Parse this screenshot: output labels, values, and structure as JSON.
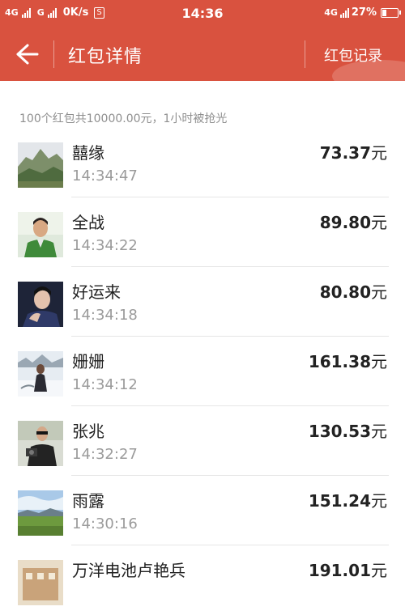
{
  "status_bar": {
    "network1": "4G",
    "network2": "G",
    "speed": "0K/s",
    "box_icon_label": "S",
    "time": "14:36",
    "network3": "4G",
    "battery_percent": "27%"
  },
  "header": {
    "back_icon": "arrow-left-icon",
    "title": "红包详情",
    "record_label": "红包记录"
  },
  "summary": "100个红包共10000.00元，1小时被抢光",
  "list": [
    {
      "name": "囍缘",
      "time": "14:34:47",
      "amount": "73.37",
      "unit": "元",
      "avatar": "landscape-hill"
    },
    {
      "name": "全战",
      "time": "14:34:22",
      "amount": "89.80",
      "unit": "元",
      "avatar": "man-green-shirt"
    },
    {
      "name": "好运来",
      "time": "14:34:18",
      "amount": "80.80",
      "unit": "元",
      "avatar": "man-dark-portrait"
    },
    {
      "name": "姗姗",
      "time": "14:34:12",
      "amount": "161.38",
      "unit": "元",
      "avatar": "snow-scene"
    },
    {
      "name": "张兆",
      "time": "14:32:27",
      "amount": "130.53",
      "unit": "元",
      "avatar": "man-camera"
    },
    {
      "name": "雨露",
      "time": "14:30:16",
      "amount": "151.24",
      "unit": "元",
      "avatar": "grassland-sky"
    },
    {
      "name": "万洋电池卢艳兵",
      "time": "",
      "amount": "191.01",
      "unit": "元",
      "avatar": "building"
    }
  ],
  "colors": {
    "header_bg": "#d9523f",
    "text": "#222222",
    "muted": "#9b9b9b"
  }
}
